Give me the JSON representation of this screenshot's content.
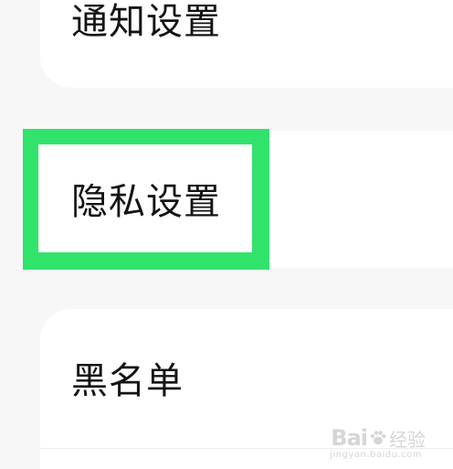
{
  "settings": {
    "items": [
      {
        "label": "通知设置"
      },
      {
        "label": "隐私设置"
      },
      {
        "label": "黑名单"
      }
    ]
  },
  "annotation": {
    "highlight_color": "#32e36b",
    "highlighted_item": "隐私设置"
  },
  "watermark": {
    "logo_text": "Bai",
    "logo_suffix": "经验",
    "url": "jingyan.baidu.com"
  }
}
